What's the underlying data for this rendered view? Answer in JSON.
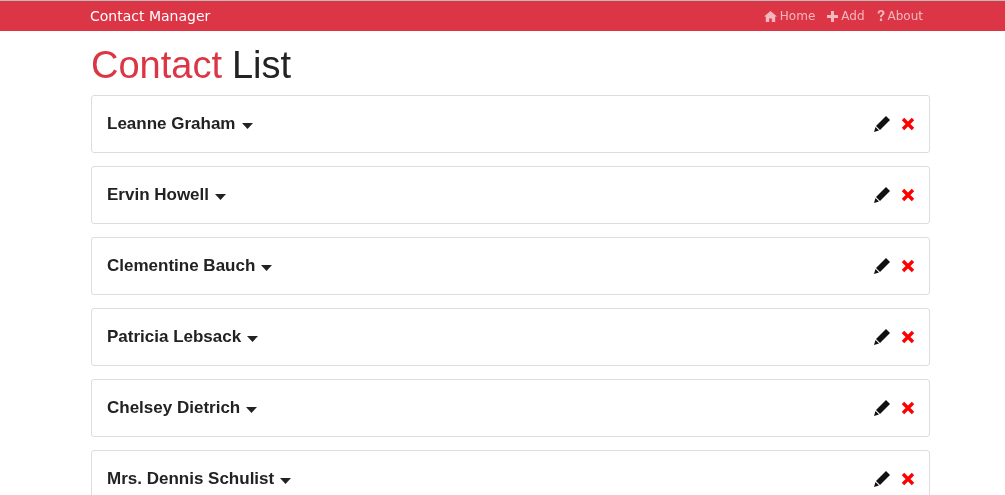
{
  "navbar": {
    "brand": "Contact Manager",
    "links": [
      {
        "kind": "home",
        "label": "Home"
      },
      {
        "kind": "add",
        "label": "Add"
      },
      {
        "kind": "about",
        "label": "About"
      }
    ]
  },
  "heading": {
    "accent": "Contact",
    "rest": "List"
  },
  "contacts": [
    {
      "name": "Leanne Graham"
    },
    {
      "name": "Ervin Howell"
    },
    {
      "name": "Clementine Bauch"
    },
    {
      "name": "Patricia Lebsack"
    },
    {
      "name": "Chelsey Dietrich"
    },
    {
      "name": "Mrs. Dennis Schulist"
    }
  ]
}
